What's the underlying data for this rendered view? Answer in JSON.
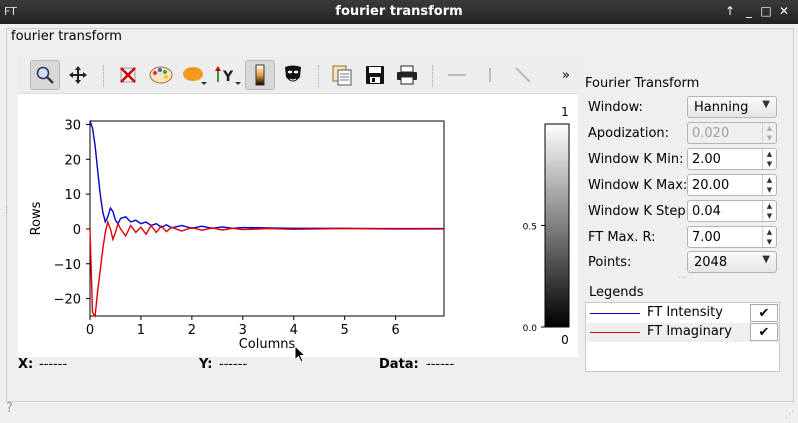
{
  "window": {
    "title": "fourier transform",
    "app_icon": "FT",
    "buttons": [
      "↑",
      "_",
      "□",
      "✕"
    ]
  },
  "group_title": "fourier transform",
  "toolbar": {
    "items": [
      {
        "name": "zoom-icon",
        "active": true
      },
      {
        "name": "pan-icon",
        "active": false
      },
      {
        "name": "clear-icon",
        "active": false
      },
      {
        "name": "palette-icon",
        "active": false
      },
      {
        "name": "marker-icon",
        "active": false
      },
      {
        "name": "y-axis-icon",
        "active": false
      },
      {
        "name": "colorbar-icon",
        "active": true
      },
      {
        "name": "mask-icon",
        "active": false
      },
      {
        "name": "copy-icon",
        "active": false
      },
      {
        "name": "save-icon",
        "active": false
      },
      {
        "name": "print-icon",
        "active": false
      },
      {
        "name": "hline-icon",
        "active": false
      },
      {
        "name": "vline-icon",
        "active": false
      },
      {
        "name": "line-icon",
        "active": false
      }
    ],
    "overflow": "»"
  },
  "chart_data": {
    "type": "line",
    "xlabel": "Columns",
    "ylabel": "Rows",
    "xlim": [
      0,
      6.95
    ],
    "ylim": [
      -25,
      31
    ],
    "xticks": [
      "0",
      "1",
      "2",
      "3",
      "4",
      "5",
      "6"
    ],
    "yticks": [
      "−20",
      "−10",
      "0",
      "10",
      "20",
      "30"
    ],
    "series": [
      {
        "name": "FT Intensity",
        "color": "#0000cc",
        "x": [
          0,
          0.05,
          0.1,
          0.15,
          0.2,
          0.25,
          0.3,
          0.35,
          0.4,
          0.45,
          0.5,
          0.55,
          0.6,
          0.7,
          0.8,
          0.9,
          1.0,
          1.1,
          1.2,
          1.3,
          1.4,
          1.5,
          1.6,
          1.8,
          2.0,
          2.2,
          2.4,
          2.6,
          2.8,
          3.0,
          3.5,
          4.0,
          5.0,
          6.0,
          6.95
        ],
        "y": [
          31,
          29,
          24,
          17,
          10,
          5,
          2,
          3.5,
          6,
          5,
          2.5,
          1.5,
          3,
          3.5,
          2,
          2.5,
          1.5,
          2,
          1,
          1.5,
          0.5,
          1.2,
          0.3,
          1.0,
          0.2,
          0.8,
          0.2,
          0.6,
          0.2,
          0.4,
          0.3,
          0.2,
          0.2,
          0.1,
          0.1
        ]
      },
      {
        "name": "FT Imaginary",
        "color": "#e00000",
        "x": [
          0,
          0.05,
          0.1,
          0.15,
          0.2,
          0.25,
          0.3,
          0.35,
          0.4,
          0.45,
          0.5,
          0.55,
          0.6,
          0.7,
          0.8,
          0.9,
          1.0,
          1.1,
          1.2,
          1.3,
          1.4,
          1.5,
          1.6,
          1.8,
          2.0,
          2.2,
          2.4,
          2.6,
          2.8,
          3.0,
          3.5,
          4.0,
          5.0,
          6.0,
          6.95
        ],
        "y": [
          0,
          -24,
          -25,
          -18,
          -12,
          -6,
          -1,
          2,
          0,
          -3,
          -1,
          1.5,
          0,
          -2,
          1,
          -1,
          0.5,
          -1.5,
          1,
          -1,
          0.8,
          -0.8,
          0.5,
          -0.6,
          0.4,
          -0.4,
          0.3,
          -0.3,
          0.2,
          -0.2,
          0.1,
          -0.1,
          0.1,
          -0.05,
          0
        ]
      }
    ],
    "colorbar": {
      "top_label": "1",
      "bottom_label": "0",
      "ticks": [
        "0.5",
        "0.0"
      ]
    }
  },
  "status": {
    "x_label": "X:",
    "x_value": "------",
    "y_label": "Y:",
    "y_value": "------",
    "data_label": "Data:",
    "data_value": "------"
  },
  "panel": {
    "title": "Fourier Transform",
    "fields": [
      {
        "label": "Window:",
        "value": "Hanning",
        "type": "combo",
        "enabled": true
      },
      {
        "label": "Apodization:",
        "value": "0.020",
        "type": "spin",
        "enabled": false
      },
      {
        "label": "Window K Min:",
        "value": "2.00",
        "type": "spin",
        "enabled": true
      },
      {
        "label": "Window K Max:",
        "value": "20.00",
        "type": "spin",
        "enabled": true
      },
      {
        "label": "Window K Step:",
        "value": "0.04",
        "type": "spin",
        "enabled": true
      },
      {
        "label": "FT Max. R:",
        "value": "7.00",
        "type": "spin",
        "enabled": true
      },
      {
        "label": "Points:",
        "value": "2048",
        "type": "combo",
        "enabled": true
      }
    ]
  },
  "legends": {
    "title": "Legends",
    "items": [
      {
        "name": "FT Intensity",
        "color": "#0000cc",
        "checked": "✔"
      },
      {
        "name": "FT Imaginary",
        "color": "#e00000",
        "checked": "✔"
      }
    ]
  },
  "help_icon": "?"
}
